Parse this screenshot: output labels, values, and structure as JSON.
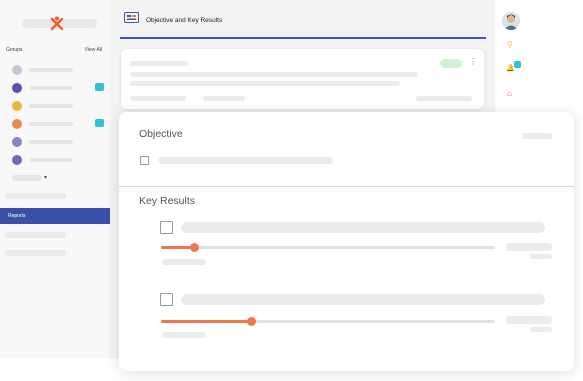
{
  "topbar": {
    "title": "Objective and Key Results"
  },
  "sidebar": {
    "groups_label": "Groups",
    "view_all_label": "View All",
    "groups": [
      {
        "avatar_color": "#c9c4d6",
        "badge": false
      },
      {
        "avatar_color": "#5a4fb0",
        "badge": true
      },
      {
        "avatar_color": "#f2b33b",
        "badge": false
      },
      {
        "avatar_color": "#f08a4b",
        "badge": true
      },
      {
        "avatar_color": "#8b83c9",
        "badge": false
      },
      {
        "avatar_color": "#6e69b8",
        "badge": false
      }
    ],
    "more_caret": "▾",
    "active_item": "Reports"
  },
  "right_rail": {
    "search_icon": "⚲",
    "bell_icon": "🔔",
    "gift_icon": "⌂"
  },
  "card": {
    "menu_icon": "⋮"
  },
  "okr": {
    "objective_title": "Objective",
    "key_results_title": "Key Results",
    "key_results": [
      {
        "progress": 0.1
      },
      {
        "progress": 0.27
      }
    ]
  },
  "colors": {
    "accent": "#3d56b5",
    "active_nav": "#3b4ea8",
    "progress": "#f0764b",
    "badge": "#2bc4d6",
    "status_pill": "#cdf2d3"
  }
}
